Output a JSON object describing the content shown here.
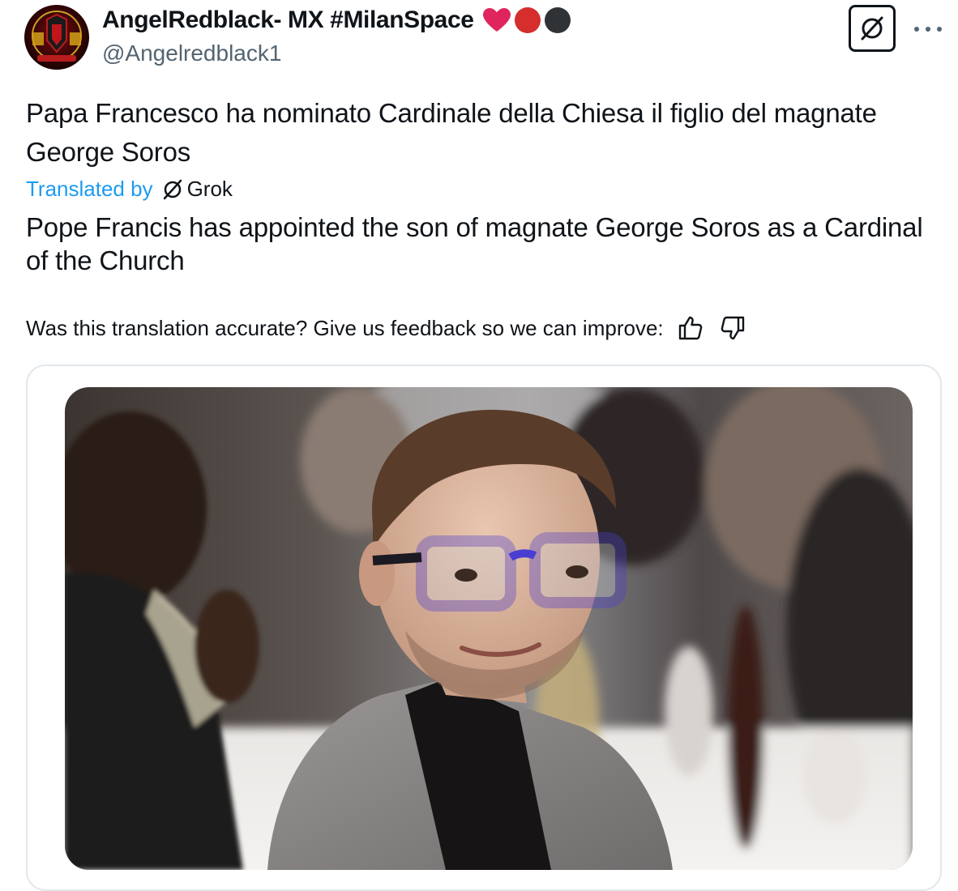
{
  "author": {
    "display_name": "AngelRedblack- MX #MilanSpace",
    "handle": "@Angelredblack1",
    "emoji_colors": [
      "#e0245e",
      "#d62d2d",
      "#2f3336"
    ]
  },
  "tweet": {
    "text": "Papa Francesco ha nominato Cardinale della Chiesa il figlio del magnate George Soros",
    "translated_by_label": "Translated by",
    "translator_name": "Grok",
    "translation": "Pope Francis has appointed the son of magnate George Soros as a Cardinal of the Church",
    "feedback_prompt": "Was this translation accurate? Give us feedback so we can improve:"
  },
  "actions": {
    "grok_icon": "grok-slash-icon",
    "more_icon": "more-dots-icon",
    "thumbs_up_icon": "thumbs-up-icon",
    "thumbs_down_icon": "thumbs-down-icon"
  },
  "colors": {
    "link": "#1d9bf0",
    "secondary_text": "#536471",
    "primary_text": "#0f1419"
  }
}
